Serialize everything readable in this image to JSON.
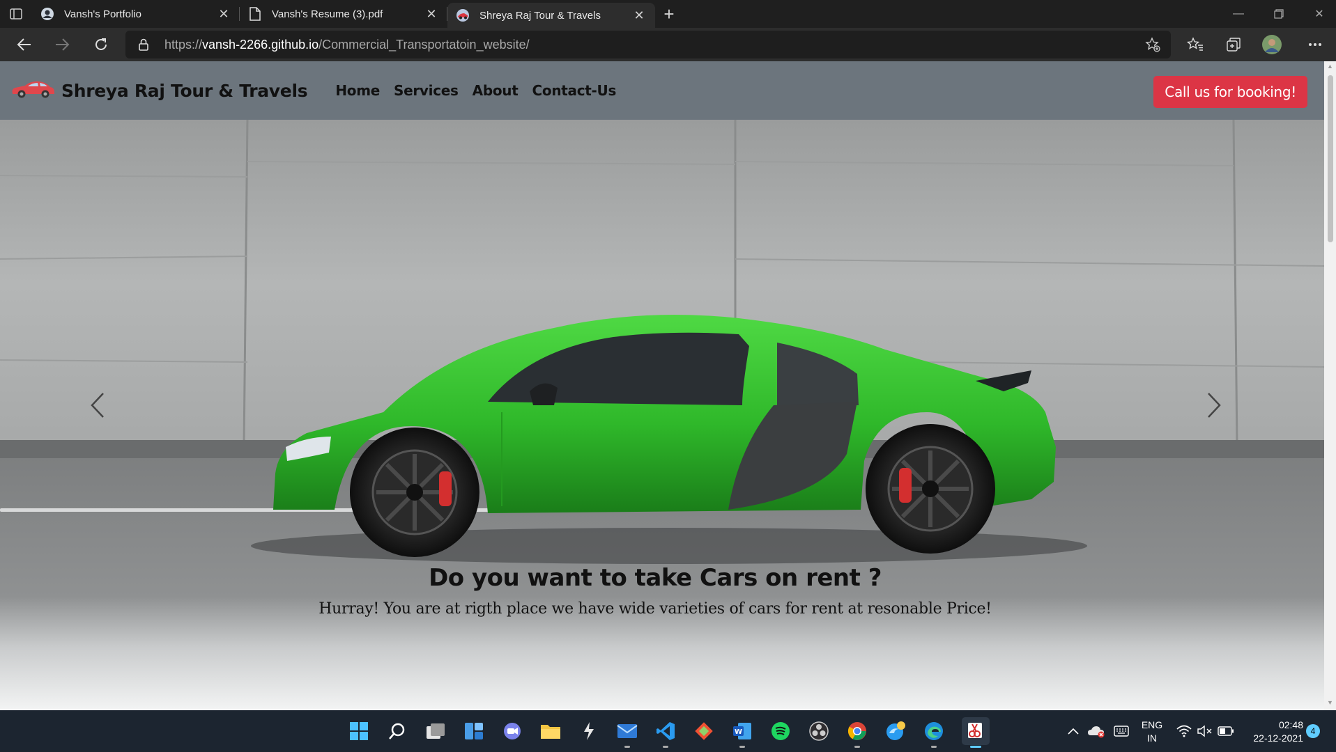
{
  "browser": {
    "tabs": [
      {
        "title": "Vansh's Portfolio",
        "favicon": "avatar-icon",
        "active": false
      },
      {
        "title": "Vansh's Resume (3).pdf",
        "favicon": "document-icon",
        "active": false
      },
      {
        "title": "Shreya Raj Tour & Travels",
        "favicon": "site-icon",
        "active": true
      }
    ],
    "url_scheme": "https://",
    "url_host": "vansh-2266.github.io",
    "url_path": "/Commercial_Transportatoin_website/"
  },
  "site": {
    "brand": "Shreya Raj Tour & Travels",
    "brand_icon": "car-icon",
    "nav": [
      "Home",
      "Services",
      "About",
      "Contact-Us"
    ],
    "cta": "Call us for booking!",
    "hero": {
      "heading": "Do you want to take Cars on rent ?",
      "subheading": "Hurray! You are at rigth place we have wide varieties of cars for rent at resonable Price!"
    },
    "colors": {
      "navbar": "#6c757d",
      "cta": "#dc3545",
      "car": "#3cc832"
    }
  },
  "taskbar": {
    "language": [
      "ENG",
      "IN"
    ],
    "time": "02:48",
    "date": "22-12-2021",
    "notifications": "4"
  }
}
